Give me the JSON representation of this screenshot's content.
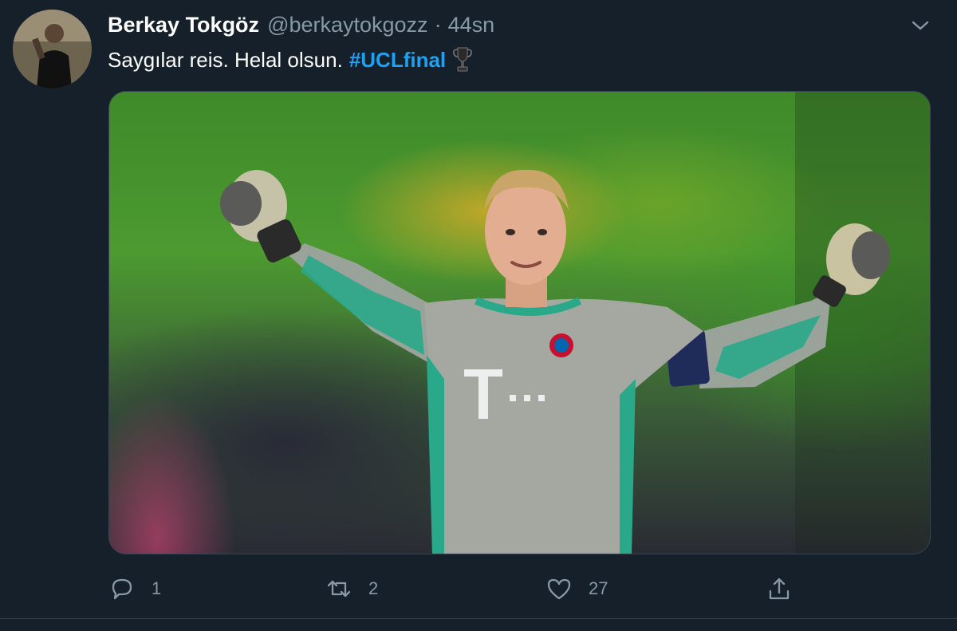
{
  "tweet": {
    "author_name": "Berkay Tokgöz",
    "author_handle": "@berkaytokgozz",
    "separator": "·",
    "time": "44sn",
    "text": "Saygılar reis. Helal olsun.",
    "hashtag": "#UCLfinal",
    "media_description_icon": "photo-image"
  },
  "actions": {
    "reply_count": "1",
    "retweet_count": "2",
    "like_count": "27"
  },
  "icons": {
    "caret": "chevron-down-icon",
    "trophy": "trophy-icon",
    "reply": "reply-icon",
    "retweet": "retweet-icon",
    "like": "heart-icon",
    "share": "share-icon"
  },
  "colors": {
    "background": "#15202b",
    "hashtag": "#1da1f2",
    "muted": "#8899a6",
    "border": "#38444d"
  }
}
